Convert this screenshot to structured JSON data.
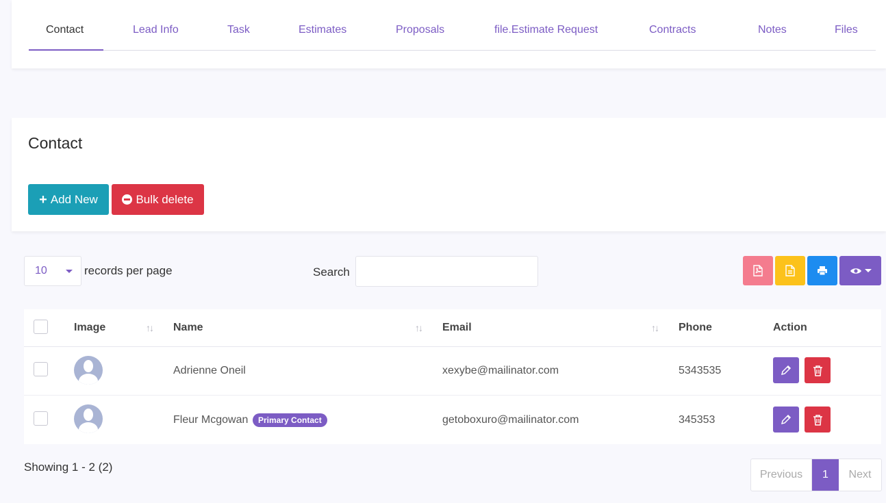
{
  "tabs": [
    {
      "label": "Contact",
      "active": true
    },
    {
      "label": "Lead Info"
    },
    {
      "label": "Task"
    },
    {
      "label": "Estimates"
    },
    {
      "label": "Proposals"
    },
    {
      "label": "file.Estimate Request"
    },
    {
      "label": "Contracts"
    },
    {
      "label": "Notes"
    },
    {
      "label": "Files"
    }
  ],
  "contact": {
    "title": "Contact",
    "add_label": "Add New",
    "bulk_label": "Bulk delete"
  },
  "controls": {
    "per_page_value": "10",
    "per_page_label": "records per page",
    "search_label": "Search",
    "search_value": "",
    "tools": [
      "pdf-icon",
      "csv-icon",
      "print-icon",
      "eye-icon"
    ]
  },
  "table": {
    "headers": {
      "image": "Image",
      "name": "Name",
      "email": "Email",
      "phone": "Phone",
      "action": "Action"
    },
    "rows": [
      {
        "name": "Adrienne Oneil",
        "badge": "",
        "email": "xexybe@mailinator.com",
        "phone": "5343535"
      },
      {
        "name": "Fleur Mcgowan",
        "badge": "Primary Contact",
        "email": "getoboxuro@mailinator.com",
        "phone": "345353"
      }
    ]
  },
  "footer": {
    "showing": "Showing 1 - 2 (2)",
    "prev": "Previous",
    "current": "1",
    "next": "Next"
  },
  "colors": {
    "accent": "#7c5cc4",
    "add": "#1b9fb6",
    "danger": "#dc3545",
    "pdf": "#f47c8e",
    "csv": "#fcc21b",
    "print": "#1d8cf0"
  }
}
